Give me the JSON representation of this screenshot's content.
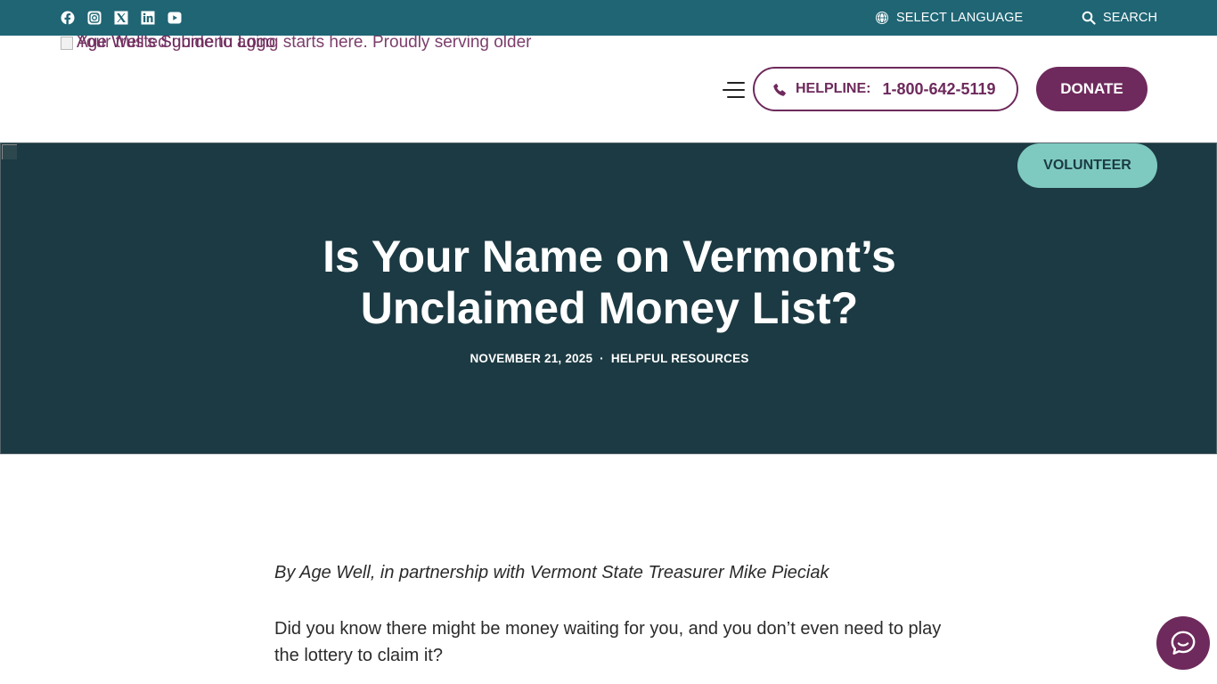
{
  "topbar": {
    "social_icons": [
      "facebook-icon",
      "instagram-icon",
      "x-icon",
      "linkedin-icon",
      "youtube-icon"
    ],
    "language_label": "SELECT LANGUAGE",
    "search_label": "SEARCH"
  },
  "header": {
    "logo_alt_1": "Age Well's Submenu Logo",
    "logo_alt_2": "Your trusted guide to aging starts here. Proudly serving older",
    "helpline_label": "HELPLINE:",
    "helpline_number": "1-800-642-5119",
    "donate_label": "DONATE"
  },
  "hero": {
    "volunteer_label": "VOLUNTEER",
    "title_line_1": "Is Your Name on Vermont’s",
    "title_line_2": "Unclaimed Money List?",
    "date": "NOVEMBER 21, 2025",
    "separator": "·",
    "category": "HELPFUL RESOURCES"
  },
  "article": {
    "byline": "By Age Well, in partnership with Vermont State Treasurer Mike Pieciak",
    "paragraph_1": "Did you know there might be money waiting for you, and you don’t even need to play the lottery to claim it?"
  },
  "colors": {
    "topbar": "#1f6574",
    "brand_purple": "#6e2a5c",
    "hero_bg": "#1c3a43",
    "volunteer_bg": "#7ecac0"
  }
}
